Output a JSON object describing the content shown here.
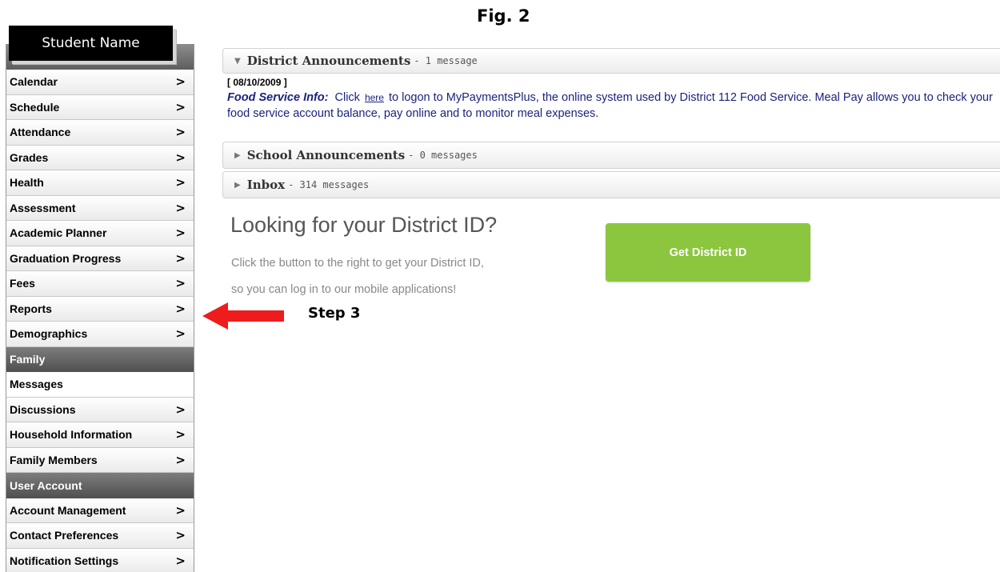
{
  "figure": {
    "caption": "Fig. 2"
  },
  "student_name": "Student Name",
  "sidebar": {
    "items_a": [
      {
        "label": "Calendar",
        "chevron": ">"
      },
      {
        "label": "Schedule",
        "chevron": ">"
      },
      {
        "label": "Attendance",
        "chevron": ">"
      },
      {
        "label": "Grades",
        "chevron": ">"
      },
      {
        "label": "Health",
        "chevron": ">"
      },
      {
        "label": "Assessment",
        "chevron": ">"
      },
      {
        "label": "Academic Planner",
        "chevron": ">"
      },
      {
        "label": "Graduation Progress",
        "chevron": ">"
      },
      {
        "label": "Fees",
        "chevron": ">"
      },
      {
        "label": "Reports",
        "chevron": ">"
      },
      {
        "label": "Demographics",
        "chevron": ">"
      }
    ],
    "section_family": "Family",
    "items_b": [
      {
        "label": "Messages"
      },
      {
        "label": "Discussions",
        "chevron": ">"
      },
      {
        "label": "Household Information",
        "chevron": ">"
      },
      {
        "label": "Family Members",
        "chevron": ">"
      }
    ],
    "section_user": "User Account",
    "items_c": [
      {
        "label": "Account Management",
        "chevron": ">"
      },
      {
        "label": "Contact Preferences",
        "chevron": ">"
      },
      {
        "label": "Notification Settings",
        "chevron": ">"
      }
    ]
  },
  "announcements": {
    "district": {
      "title": "District Announcements",
      "count": "- 1 message"
    },
    "message": {
      "date": "[ 08/10/2009 ]",
      "title": "Food Service Info:",
      "pre_link": "Click",
      "link": "here",
      "post_link": "to logon to MyPaymentsPlus, the online system used by District 112 Food Service.  Meal Pay allows you to check your food service account balance, pay online and to monitor meal expenses."
    },
    "school": {
      "title": "School Announcements",
      "count": "- 0 messages"
    },
    "inbox": {
      "title": "Inbox",
      "count": "- 314 messages"
    }
  },
  "district_id": {
    "heading": "Looking for your District ID?",
    "line1": "Click the button to the right to get your District ID,",
    "line2": "so you can log in to our mobile applications!",
    "button": "Get District ID"
  },
  "annotation": {
    "step": "Step 3",
    "arrow_color": "#ee1c1c"
  }
}
